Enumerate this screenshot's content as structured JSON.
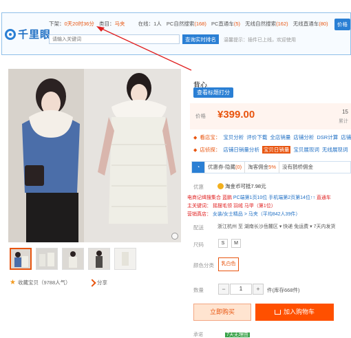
{
  "plugin": {
    "logo_text": "千里眼",
    "down_label": "下架：",
    "down_value": "0天20时36分",
    "category_label": "类目：",
    "category_value": "马夹",
    "online_label": "在线：",
    "online_value": "1人",
    "pc_natural_label": "PC自然搜索",
    "pc_natural_value": "(168)",
    "pc_train_label": "PC直通车",
    "pc_train_value": "(5)",
    "wireless_natural_label": "无线自然搜索",
    "wireless_natural_value": "(162)",
    "wireless_train_label": "无线直通车",
    "wireless_train_value": "(80)",
    "price_button": "价格",
    "search_placeholder": "请输入关键词",
    "search_button": "查询实时排名",
    "note": "温馨提示：插件已上线，欢迎使用"
  },
  "product": {
    "title": "背心",
    "tag_button": "查看标题打分",
    "price_label": "价格",
    "price": "¥399.00",
    "price_side_top": "15",
    "price_side_bottom": "累计",
    "favorite_label": "收藏宝贝（9788人气）",
    "share_label": "分享"
  },
  "tools": {
    "row1_lead": "看店宝：",
    "row1_items": [
      "宝贝分析",
      "评价下载",
      "全店销量",
      "店铺分析",
      "DSR计算",
      "店铺上"
    ],
    "row2_lead": "店侦探：",
    "row2_items": [
      "店铺日销量分析",
      "宝贝日销量",
      "宝贝展现词",
      "无线展现词"
    ],
    "row2_highlight_index": 1
  },
  "promo": {
    "item1": "优惠券-隐藏",
    "item1_count": "(0)",
    "item2": "淘客佣金",
    "item2_value": "5%",
    "item3": "没有鹊桥佣金"
  },
  "details": {
    "youhui_label": "优惠",
    "youhui_value": "淘金币可抵7.98元",
    "line1_red": "电商记缉搜集合 蓝鹏",
    "line1_blue": "PC端第1页10位",
    "line1_blue2": "手机端第2页第14位↑↑",
    "line1_red2": "直通车",
    "line2_label": "主关键词：",
    "line2_value": "摇摆毛领 羽绒 马甲（第1位）",
    "line3_label": "营销真店：",
    "line3_value": "女装/女士精品 > 马夹（平均842人39件）",
    "ship_label": "配送",
    "ship_value": "浙江杭州 至 湖南长沙岳麓区 ▾  快递 免运费 ▾  7天内发货",
    "size_label": "尺码",
    "sizes": [
      "S",
      "M"
    ],
    "color_label": "颜色分类",
    "color_value": "乳白色",
    "qty_label": "数量",
    "qty_minus": "−",
    "qty_value": "1",
    "qty_plus": "+",
    "stock": "件(库存668件)",
    "buy_button": "立即购买",
    "cart_button": "加入购物车",
    "bottom_label": "承诺",
    "bottom_badge": "7天无理由"
  }
}
